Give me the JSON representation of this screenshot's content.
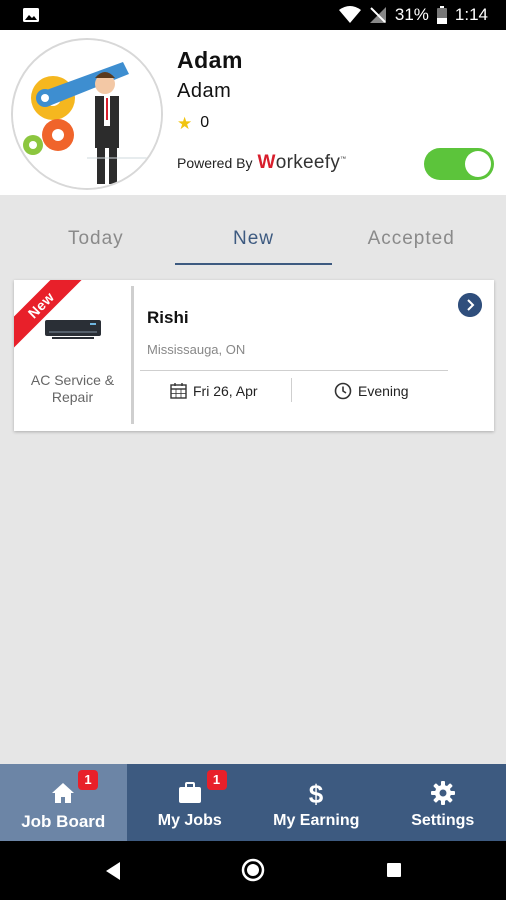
{
  "status_bar": {
    "battery": "31%",
    "time": "1:14"
  },
  "profile": {
    "name": "Adam",
    "subname": "Adam",
    "rating": "0",
    "powered_by": "Powered By",
    "brand_w": "W",
    "brand_rest": "orkeefy",
    "brand_tm": "™",
    "online_toggle": true
  },
  "tabs": [
    {
      "label": "Today"
    },
    {
      "label": "New"
    },
    {
      "label": "Accepted"
    }
  ],
  "job": {
    "ribbon": "New",
    "service": "AC Service & Repair",
    "customer": "Rishi",
    "location": "Mississauga, ON",
    "date": "Fri 26, Apr",
    "time_slot": "Evening"
  },
  "bottom_nav": [
    {
      "label": "Job Board",
      "badge": "1",
      "icon": "home-icon"
    },
    {
      "label": "My Jobs",
      "badge": "1",
      "icon": "briefcase-icon"
    },
    {
      "label": "My Earning",
      "icon": "dollar-icon"
    },
    {
      "label": "Settings",
      "icon": "gear-icon"
    }
  ],
  "colors": {
    "primary": "#3d5a80",
    "nav_active": "#6c85a6",
    "toggle_on": "#5cc43b",
    "ribbon": "#e8202a",
    "background": "#e6e6e6"
  }
}
